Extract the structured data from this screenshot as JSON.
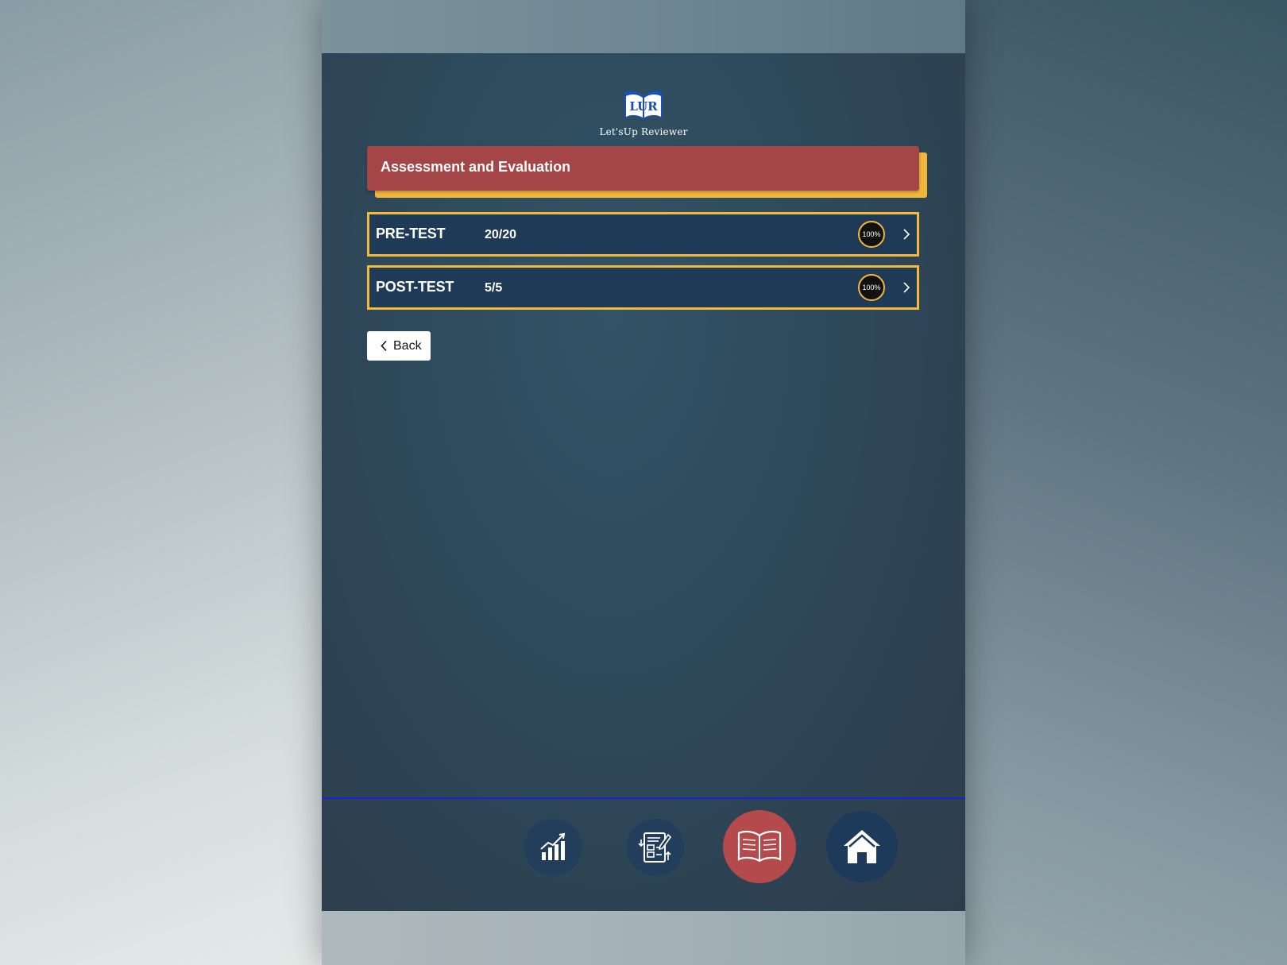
{
  "app": {
    "logo_letters": "LUR",
    "logo_text": "Let'sUp Reviewer"
  },
  "banner": {
    "title": "Assessment and Evaluation"
  },
  "tests": [
    {
      "name": "PRE-TEST",
      "score": "20/20",
      "percent": "100%"
    },
    {
      "name": "POST-TEST",
      "score": "5/5",
      "percent": "100%"
    }
  ],
  "back_button": {
    "label": "Back"
  },
  "bottom_nav": {
    "items": [
      {
        "icon": "bar-chart-icon",
        "active": false
      },
      {
        "icon": "document-edit-icon",
        "active": false
      },
      {
        "icon": "open-book-icon",
        "active": true
      },
      {
        "icon": "home-icon",
        "active": false
      }
    ]
  },
  "colors": {
    "banner": "#a44548",
    "accent": "#f2b93b",
    "row": "#1e3a57",
    "nav_active": "#b44a4c",
    "nav_inactive": "#233e5a",
    "nav_line": "#1424d4"
  }
}
